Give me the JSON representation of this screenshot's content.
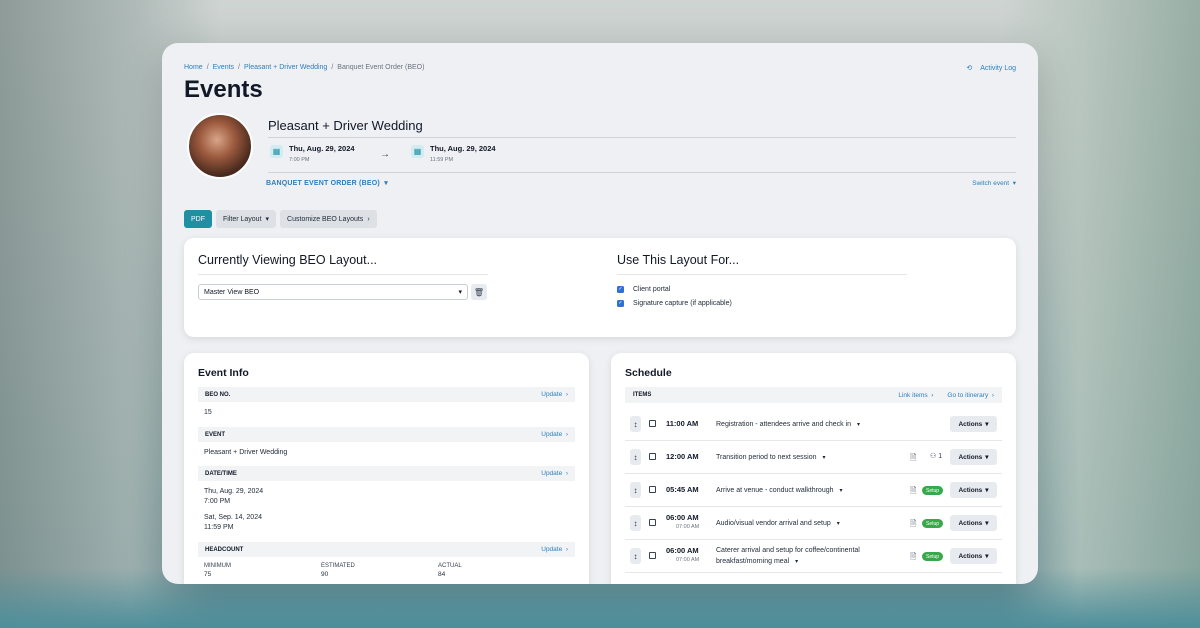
{
  "breadcrumb": [
    "Home",
    "Events",
    "Pleasant + Driver Wedding",
    "Banquet Event Order (BEO)"
  ],
  "activity_log": "Activity Log",
  "page_title": "Events",
  "event": {
    "name": "Pleasant + Driver Wedding",
    "start_date": "Thu, Aug. 29, 2024",
    "start_time": "7:00 PM",
    "end_date": "Thu, Aug. 29, 2024",
    "end_time": "11:59 PM",
    "beo_select": "BANQUET EVENT ORDER (BEO)",
    "switch_event": "Switch event"
  },
  "toolbar": {
    "pdf": "PDF",
    "filter_layout": "Filter Layout",
    "customize": "Customize BEO Layouts"
  },
  "layout": {
    "title": "Currently Viewing BEO Layout...",
    "selected": "Master View BEO",
    "use_title": "Use This Layout For...",
    "options": [
      "Client portal",
      "Signature capture (if applicable)"
    ]
  },
  "event_info": {
    "heading": "Event Info",
    "update": "Update",
    "beo_no_label": "BEO NO.",
    "beo_no": "15",
    "event_label": "EVENT",
    "event_value": "Pleasant + Driver Wedding",
    "datetime_label": "DATE/TIME",
    "dt1_date": "Thu, Aug. 29, 2024",
    "dt1_time": "7:00 PM",
    "dt2_date": "Sat, Sep. 14, 2024",
    "dt2_time": "11:59 PM",
    "headcount_label": "HEADCOUNT",
    "headcount": {
      "labels": [
        "MINIMUM",
        "ESTIMATED",
        "ACTUAL"
      ],
      "values": [
        "75",
        "90",
        "84"
      ]
    }
  },
  "schedule": {
    "heading": "Schedule",
    "items_label": "ITEMS",
    "link_items": "Link items",
    "go_itinerary": "Go to itinerary",
    "actions_label": "Actions",
    "setup_badge": "Setup",
    "rows": [
      {
        "time": "11:00 AM",
        "sub": "",
        "desc": "Registration - attendees arrive and check in",
        "desc2": ""
      },
      {
        "time": "12:00 AM",
        "sub": "",
        "desc": "Transition period to next session",
        "desc2": "",
        "guests": "1"
      },
      {
        "time": "05:45 AM",
        "sub": "",
        "desc": "Arrive at venue - conduct walkthrough",
        "desc2": ""
      },
      {
        "time": "06:00 AM",
        "sub": "07:00 AM",
        "desc": "Audio/visual vendor arrival and setup",
        "desc2": ""
      },
      {
        "time": "06:00 AM",
        "sub": "07:00 AM",
        "desc": "Caterer arrival and setup for coffee/continental",
        "desc2": "breakfast/morning meal"
      }
    ]
  }
}
